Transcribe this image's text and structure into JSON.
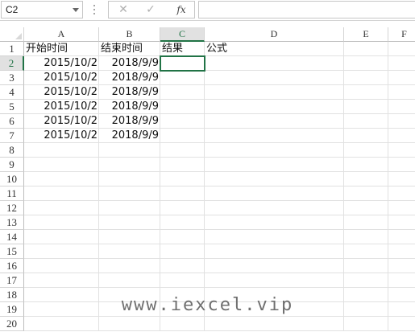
{
  "name_box": {
    "value": "C2"
  },
  "formula_bar": {
    "cancel_icon": "✕",
    "enter_icon": "✓",
    "fx_label": "fx",
    "formula": ""
  },
  "columns": [
    "A",
    "B",
    "C",
    "D",
    "E",
    "F"
  ],
  "rows": [
    "1",
    "2",
    "3",
    "4",
    "5",
    "6",
    "7",
    "8",
    "9",
    "10",
    "11",
    "12",
    "13",
    "14",
    "15",
    "16",
    "17",
    "18",
    "19",
    "20"
  ],
  "selected_cell": "C2",
  "cells": {
    "A1": "开始时间",
    "B1": "结束时间",
    "C1": "结果",
    "D1": "公式",
    "A2": "2015/10/2",
    "B2": "2018/9/9",
    "A3": "2015/10/2",
    "B3": "2018/9/9",
    "A4": "2015/10/2",
    "B4": "2018/9/9",
    "A5": "2015/10/2",
    "B5": "2018/9/9",
    "A6": "2015/10/2",
    "B6": "2018/9/9",
    "A7": "2015/10/2",
    "B7": "2018/9/9"
  },
  "watermark": "www.iexcel.vip",
  "colors": {
    "accent": "#217346",
    "gridline": "#e1e1e1",
    "header_active": "#e1e1e1"
  }
}
